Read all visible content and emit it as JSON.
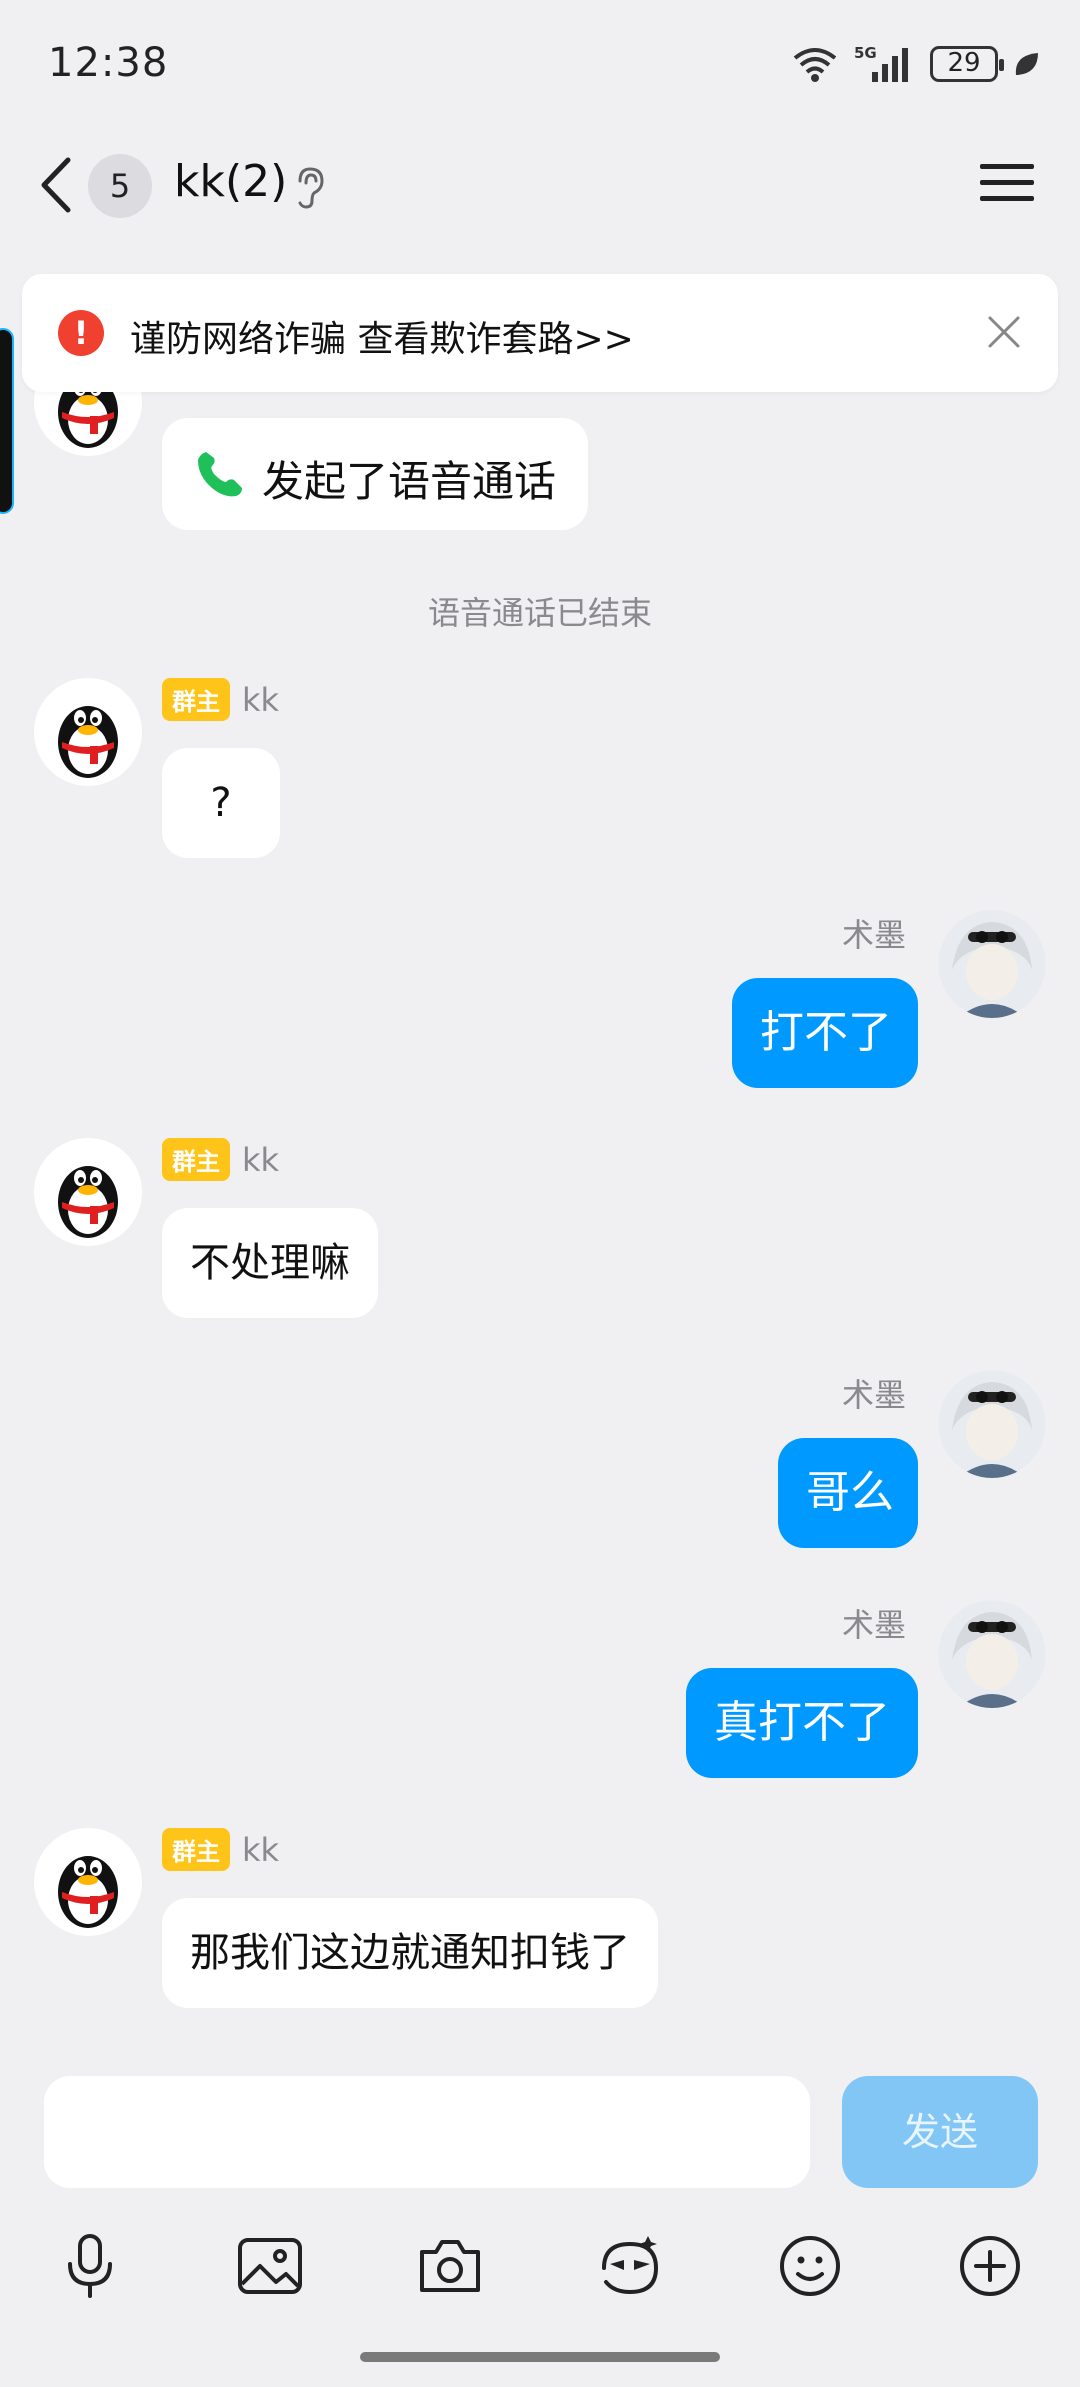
{
  "status_bar": {
    "time": "12:38",
    "network": "5G",
    "battery": "29"
  },
  "header": {
    "unread_count": "5",
    "title": "kk(2)"
  },
  "fraud_banner": {
    "text": "谨防网络诈骗 查看欺诈套路>>"
  },
  "messages": [
    {
      "type": "call",
      "text": "发起了语音通话"
    },
    {
      "type": "system",
      "text": "语音通话已结束"
    },
    {
      "type": "incoming",
      "tag": "群主",
      "sender": "kk",
      "text": "?"
    },
    {
      "type": "outgoing",
      "sender": "术墨",
      "text": "打不了"
    },
    {
      "type": "incoming",
      "tag": "群主",
      "sender": "kk",
      "text": "不处理嘛"
    },
    {
      "type": "outgoing",
      "sender": "术墨",
      "text": "哥么"
    },
    {
      "type": "outgoing",
      "sender": "术墨",
      "text": "真打不了"
    },
    {
      "type": "incoming",
      "tag": "群主",
      "sender": "kk",
      "text": "那我们这边就通知扣钱了"
    }
  ],
  "composer": {
    "input_value": "",
    "send_label": "发送"
  },
  "toolbar": [
    "mic-icon",
    "image-icon",
    "camera-icon",
    "sticker-icon",
    "emoji-icon",
    "plus-icon"
  ]
}
